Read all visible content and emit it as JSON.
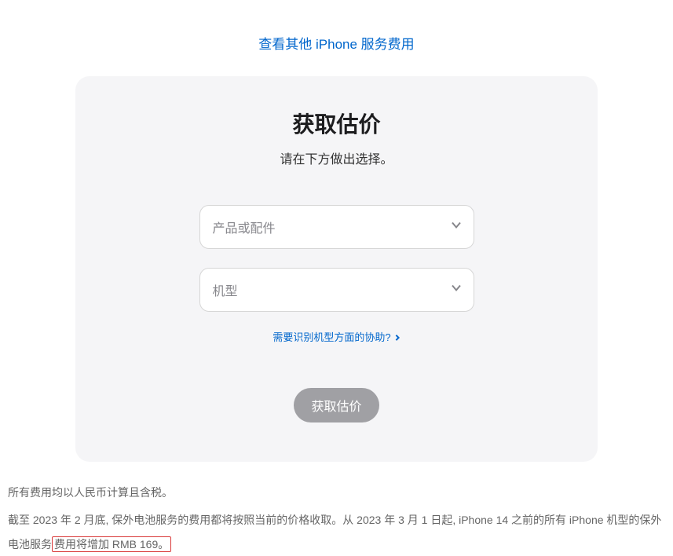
{
  "topLink": {
    "label": "查看其他 iPhone 服务费用"
  },
  "card": {
    "title": "获取估价",
    "subtitle": "请在下方做出选择。",
    "select1": {
      "placeholder": "产品或配件"
    },
    "select2": {
      "placeholder": "机型"
    },
    "helpLink": {
      "label": "需要识别机型方面的协助?"
    },
    "submit": {
      "label": "获取估价"
    }
  },
  "footnotes": {
    "line1": "所有费用均以人民币计算且含税。",
    "line2_part1": "截至 2023 年 2 月底, 保外电池服务的费用都将按照当前的价格收取。从 2023 年 3 月 1 日起, iPhone 14 之前的所有 iPhone 机型的保外电池服务",
    "line2_highlight": "费用将增加 RMB 169。"
  }
}
